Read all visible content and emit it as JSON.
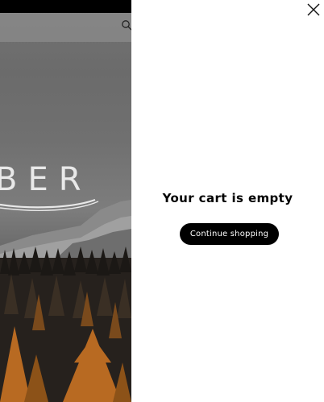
{
  "background": {
    "logo_text": "BER",
    "colors": {
      "topbar": "#000000",
      "sky": "#707070",
      "forest": "#2a2622",
      "foliage": "#b86a22"
    }
  },
  "cart": {
    "empty_message": "Your cart is empty",
    "continue_label": "Continue shopping",
    "icons": {
      "close": "close-icon",
      "search": "search-icon"
    }
  }
}
